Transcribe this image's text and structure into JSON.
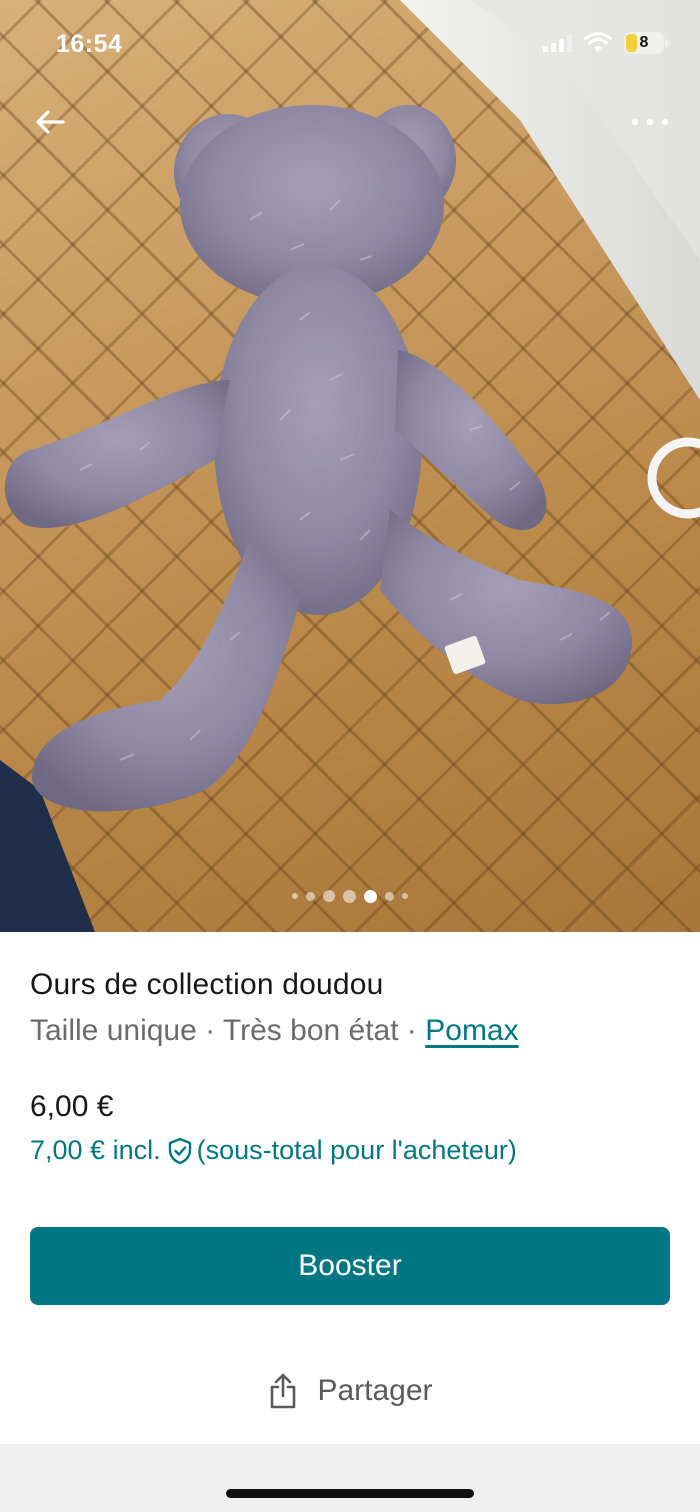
{
  "status_bar": {
    "time": "16:54",
    "battery_level": "8",
    "icons": [
      "signal-icon",
      "wifi-icon",
      "battery-icon"
    ]
  },
  "photo": {
    "nav_icons": [
      "back-arrow-icon",
      "more-options-icon"
    ],
    "carousel": {
      "total": 7,
      "active_index": 4
    }
  },
  "item": {
    "title": "Ours de collection doudou",
    "size": "Taille unique",
    "separator": " · ",
    "condition": "Très bon état",
    "brand": "Pomax"
  },
  "pricing": {
    "price": "6,00 €",
    "incl_price": "7,00 € incl.",
    "incl_note": "(sous-total pour l'acheteur)"
  },
  "actions": {
    "boost_label": "Booster",
    "share_label": "Partager"
  },
  "colors": {
    "accent": "#007782",
    "text_primary": "#171717",
    "text_secondary": "#6b6b6b"
  }
}
